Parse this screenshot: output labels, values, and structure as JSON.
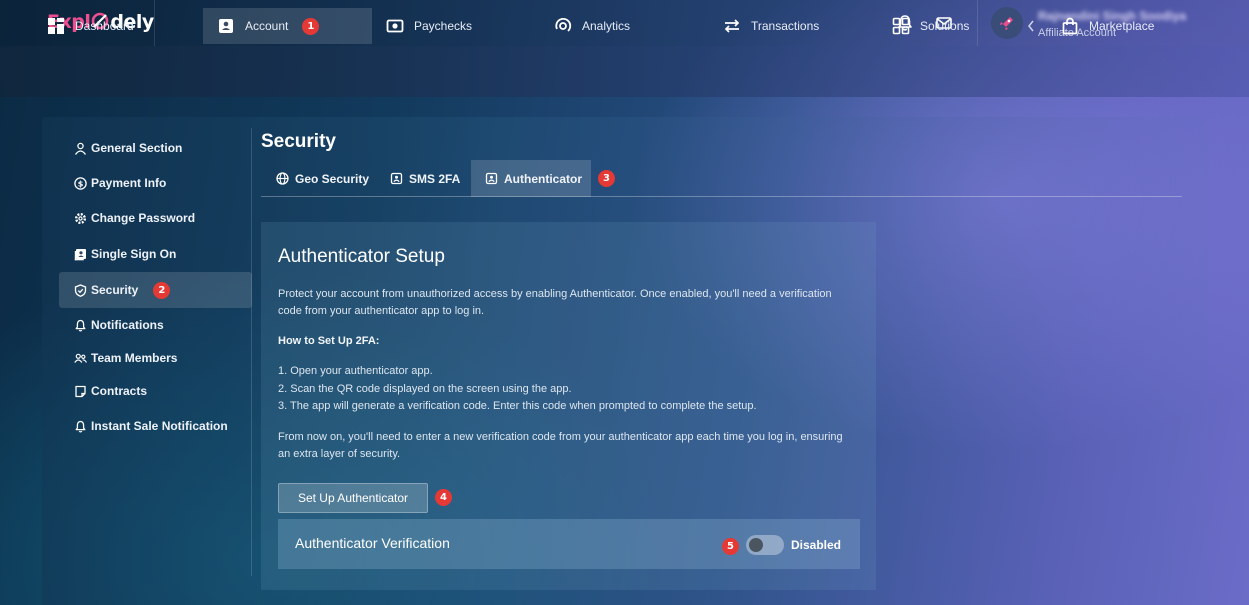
{
  "app": {
    "logo_part1": "Expl",
    "logo_part2": "dely",
    "user_name": "Rajnandini Singh Soodiya",
    "user_role": "Affiliate Account"
  },
  "nav": {
    "items": [
      {
        "label": "Dashboard",
        "icon": "dashboard-grid-icon"
      },
      {
        "label": "Account",
        "icon": "account-card-icon",
        "badge": "1",
        "active": true
      },
      {
        "label": "Paychecks",
        "icon": "paycheck-icon"
      },
      {
        "label": "Analytics",
        "icon": "analytics-icon"
      },
      {
        "label": "Transactions",
        "icon": "transactions-arrows-icon"
      },
      {
        "label": "Solutions",
        "icon": "solutions-grid-icon"
      },
      {
        "label": "Marketplace",
        "icon": "shopping-bag-icon"
      }
    ]
  },
  "sidebar": {
    "items": [
      {
        "label": "General Section",
        "icon": "user-icon"
      },
      {
        "label": "Payment Info",
        "icon": "dollar-circle-icon"
      },
      {
        "label": "Change Password",
        "icon": "gear-icon"
      },
      {
        "label": "Single Sign On",
        "icon": "sso-card-icon"
      },
      {
        "label": "Security",
        "icon": "shield-icon",
        "badge": "2",
        "active": true
      },
      {
        "label": "Notifications",
        "icon": "bell-icon"
      },
      {
        "label": "Team Members",
        "icon": "team-icon"
      },
      {
        "label": "Contracts",
        "icon": "contract-icon"
      },
      {
        "label": "Instant Sale Notification",
        "icon": "bell-icon"
      }
    ]
  },
  "security": {
    "title": "Security",
    "tabs": [
      {
        "label": "Geo Security",
        "icon": "globe-icon"
      },
      {
        "label": "SMS 2FA",
        "icon": "sms-icon"
      },
      {
        "label": "Authenticator",
        "icon": "authenticator-icon",
        "badge": "3",
        "active": true
      }
    ]
  },
  "setup": {
    "title": "Authenticator Setup",
    "intro": "Protect your account from unauthorized access by enabling Authenticator. Once enabled, you'll need a verification code from your authenticator app to log in.",
    "howto_heading": "How to Set Up 2FA:",
    "steps": [
      "1. Open your authenticator app.",
      "2. Scan the QR code displayed on the screen using the app.",
      "3. The app will generate a verification code. Enter this code when prompted to complete the setup."
    ],
    "outro": "From now on, you'll need to enter a new verification code from your authenticator app each time you log in, ensuring an extra layer of security.",
    "button_label": "Set Up Authenticator",
    "button_badge": "4",
    "verification_label": "Authenticator Verification",
    "toggle_badge": "5",
    "toggle_state": "Disabled",
    "toggle_on": false
  },
  "colors": {
    "badge": "#e53935",
    "logo_accent": "#ec4f8e"
  }
}
